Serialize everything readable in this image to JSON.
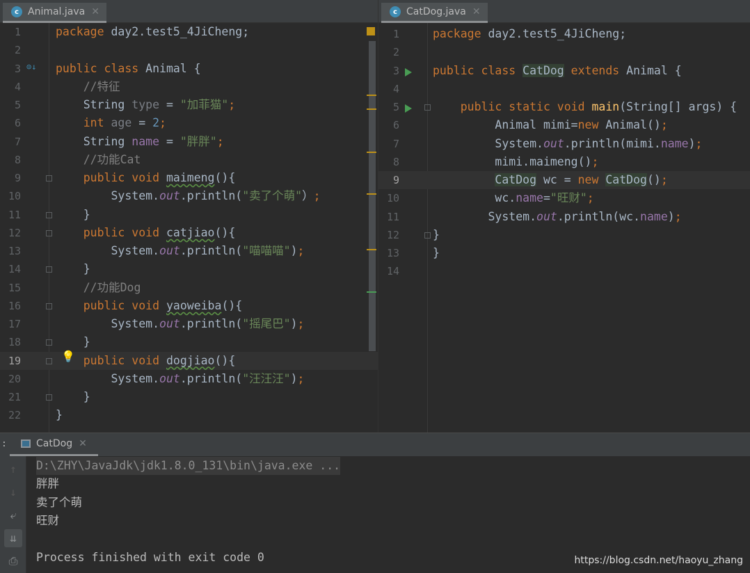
{
  "left_editor": {
    "tab": {
      "label": "Animal.java",
      "icon": "java-class-icon"
    },
    "current_line": 19,
    "lines": [
      [
        [
          "kw",
          "package "
        ],
        [
          "",
          "day2.test5_4JiCheng;"
        ]
      ],
      [],
      [
        [
          "kw",
          "public class "
        ],
        [
          "",
          "Animal {"
        ]
      ],
      [
        [
          "com",
          "    //特征"
        ]
      ],
      [
        [
          "",
          "    String "
        ],
        [
          "unused",
          "type"
        ],
        [
          "",
          " = "
        ],
        [
          "str",
          "\"加菲猫\""
        ],
        [
          "kw",
          ";"
        ]
      ],
      [
        [
          "kw",
          "    int "
        ],
        [
          "unused",
          "age"
        ],
        [
          "",
          " = "
        ],
        [
          "num",
          "2"
        ],
        [
          "kw",
          ";"
        ]
      ],
      [
        [
          "",
          "    String "
        ],
        [
          "fld",
          "name"
        ],
        [
          "",
          " = "
        ],
        [
          "str",
          "\"胖胖\""
        ],
        [
          "kw",
          ";"
        ]
      ],
      [
        [
          "com",
          "    //功能Cat"
        ]
      ],
      [
        [
          "kw",
          "    public void "
        ],
        [
          "wavy",
          "maimeng"
        ],
        [
          "",
          "(){"
        ]
      ],
      [
        [
          "",
          "        System."
        ],
        [
          "sfld",
          "out"
        ],
        [
          "",
          ".println("
        ],
        [
          "str",
          "\"卖了个萌\""
        ],
        [
          "",
          "）"
        ],
        [
          "kw",
          ";"
        ]
      ],
      [
        [
          "",
          "    }"
        ]
      ],
      [
        [
          "kw",
          "    public void "
        ],
        [
          "wavy",
          "catjiao"
        ],
        [
          "",
          "(){"
        ]
      ],
      [
        [
          "",
          "        System."
        ],
        [
          "sfld",
          "out"
        ],
        [
          "",
          ".println("
        ],
        [
          "str",
          "\"喵喵喵\""
        ],
        [
          "",
          ")"
        ],
        [
          "kw",
          ";"
        ]
      ],
      [
        [
          "",
          "    }"
        ]
      ],
      [
        [
          "com",
          "    //功能Dog"
        ]
      ],
      [
        [
          "kw",
          "    public void "
        ],
        [
          "wavy",
          "yaoweiba"
        ],
        [
          "",
          "(){"
        ]
      ],
      [
        [
          "",
          "        System."
        ],
        [
          "sfld",
          "out"
        ],
        [
          "",
          ".println("
        ],
        [
          "str",
          "\"摇尾巴\""
        ],
        [
          "",
          ")"
        ],
        [
          "kw",
          ";"
        ]
      ],
      [
        [
          "",
          "    }"
        ]
      ],
      [
        [
          "kw",
          "    public void "
        ],
        [
          "wavy",
          "dogjiao"
        ],
        [
          "",
          "(){"
        ]
      ],
      [
        [
          "",
          "        System."
        ],
        [
          "sfld",
          "out"
        ],
        [
          "",
          ".println("
        ],
        [
          "str",
          "\"汪汪汪\""
        ],
        [
          "",
          ")"
        ],
        [
          "kw",
          ";"
        ]
      ],
      [
        [
          "",
          "    }"
        ]
      ],
      [
        [
          "",
          "}"
        ]
      ]
    ]
  },
  "right_editor": {
    "tab": {
      "label": "CatDog.java",
      "icon": "java-class-run-icon"
    },
    "current_line": 9,
    "lines": [
      [
        [
          "kw",
          "package "
        ],
        [
          "",
          "day2.test5_4JiCheng;"
        ]
      ],
      [],
      [
        [
          "kw",
          "public class "
        ],
        [
          "hl",
          "CatDog"
        ],
        [
          "kw",
          " extends "
        ],
        [
          "",
          "Animal {"
        ]
      ],
      [],
      [
        [
          "kw",
          "    public static void "
        ],
        [
          "mdecl",
          "main"
        ],
        [
          "",
          "(String[] args) {"
        ]
      ],
      [
        [
          "",
          "         Animal mimi="
        ],
        [
          "kw",
          "new "
        ],
        [
          "",
          "Animal()"
        ],
        [
          "kw",
          ";"
        ]
      ],
      [
        [
          "",
          "         System."
        ],
        [
          "sfld",
          "out"
        ],
        [
          "",
          ".println(mimi."
        ],
        [
          "fld",
          "name"
        ],
        [
          "",
          ")"
        ],
        [
          "kw",
          ";"
        ]
      ],
      [
        [
          "",
          "         mimi.maimeng()"
        ],
        [
          "kw",
          ";"
        ]
      ],
      [
        [
          "",
          "         "
        ],
        [
          "hl",
          "CatDog"
        ],
        [
          "",
          " wc = "
        ],
        [
          "kw",
          "new "
        ],
        [
          "hl",
          "CatDog"
        ],
        [
          "",
          "()"
        ],
        [
          "kw",
          ";"
        ]
      ],
      [
        [
          "",
          "         wc."
        ],
        [
          "fld",
          "name"
        ],
        [
          "",
          "="
        ],
        [
          "str",
          "\"旺财\""
        ],
        [
          "kw",
          ";"
        ]
      ],
      [
        [
          "",
          "        System."
        ],
        [
          "sfld",
          "out"
        ],
        [
          "",
          ".println(wc."
        ],
        [
          "fld",
          "name"
        ],
        [
          "",
          ")"
        ],
        [
          "kw",
          ";"
        ]
      ],
      [
        [
          "",
          "}"
        ]
      ],
      [
        [
          "",
          "}"
        ]
      ],
      []
    ]
  },
  "run_panel": {
    "tab_label": "CatDog",
    "output": [
      "D:\\ZHY\\JavaJdk\\jdk1.8.0_131\\bin\\java.exe ...",
      "胖胖",
      "卖了个萌",
      "旺财",
      "",
      "Process finished with exit code 0"
    ],
    "toolbar": [
      "arrow-up-icon",
      "arrow-down-icon",
      "soft-wrap-icon",
      "scroll-to-end-icon",
      "print-icon"
    ]
  },
  "watermark": "https://blog.csdn.net/haoyu_zhang"
}
